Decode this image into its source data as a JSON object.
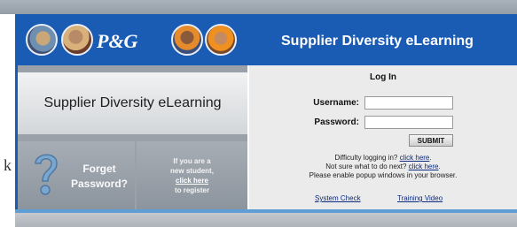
{
  "header": {
    "logo_text": "P&G",
    "title": "Supplier Diversity eLearning",
    "photos": [
      "photo-1",
      "photo-2",
      "photo-3",
      "photo-4"
    ]
  },
  "left_panel": {
    "banner_title": "Supplier Diversity eLearning",
    "forget_password": {
      "line1": "Forget",
      "line2": "Password?",
      "icon": "question-mark-icon"
    },
    "new_student": {
      "line1": "If you are a",
      "line2": "new student,",
      "link": "click here",
      "line4": "to register"
    }
  },
  "login": {
    "title": "Log In",
    "username_label": "Username:",
    "username_value": "",
    "password_label": "Password:",
    "password_value": "",
    "submit_label": "SUBMIT",
    "help": {
      "line1_text": "Difficulty logging in? ",
      "line1_link": "click here",
      "line1_end": ".",
      "line2_text": "Not sure what to do next? ",
      "line2_link": "click here",
      "line2_end": ".",
      "line3": "Please enable popup windows in your browser."
    },
    "footer_links": {
      "system_check": "System Check",
      "training_video": "Training Video"
    }
  },
  "edge_fragment": "k",
  "colors": {
    "header_blue": "#1a5bb3",
    "accent_light_blue": "#5f9ed4",
    "panel_gray": "#9aa1a9",
    "login_bg": "#ebebeb",
    "link": "#0b2a80"
  }
}
